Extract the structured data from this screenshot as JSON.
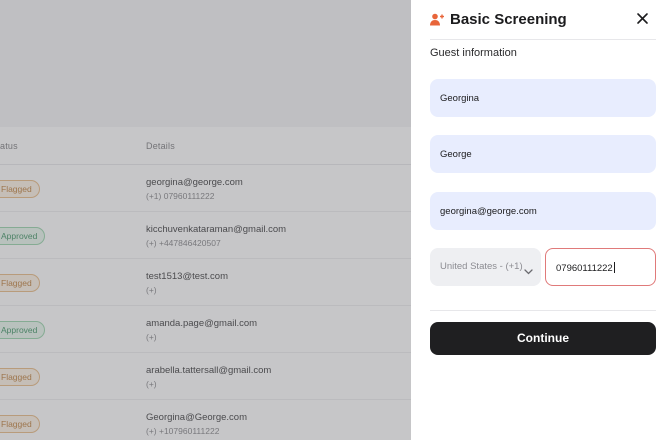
{
  "background_table": {
    "columns": [
      "atus",
      "Details"
    ],
    "rows": [
      {
        "status": "Flagged",
        "email": "georgina@george.com",
        "phone": "(+1) 07960111222"
      },
      {
        "status": "Approved",
        "email": "kicchuvenkataraman@gmail.com",
        "phone": "(+) +447846420507"
      },
      {
        "status": "Flagged",
        "email": "test1513@test.com",
        "phone": "(+)"
      },
      {
        "status": "Approved",
        "email": "amanda.page@gmail.com",
        "phone": "(+)"
      },
      {
        "status": "Flagged",
        "email": "arabella.tattersall@gmail.com",
        "phone": "(+)"
      },
      {
        "status": "Flagged",
        "email": "Georgina@George.com",
        "phone": "(+) +107960111222"
      }
    ]
  },
  "panel": {
    "title": "Basic Screening",
    "header_icon": "add-person-icon",
    "close_icon": "close-icon",
    "section_label": "Guest information",
    "fields": {
      "first_name": "Georgina",
      "last_name": "George",
      "email": "georgina@george.com",
      "country": "United States - (+1)",
      "phone": "07960111222"
    },
    "continue_label": "Continue"
  },
  "colors": {
    "accent": "#e8653a",
    "field_bg": "#e8edfe",
    "error_border": "#e07a7a",
    "button_bg": "#1f1f21",
    "flagged": "#b9742a",
    "approved": "#2e8b57"
  }
}
